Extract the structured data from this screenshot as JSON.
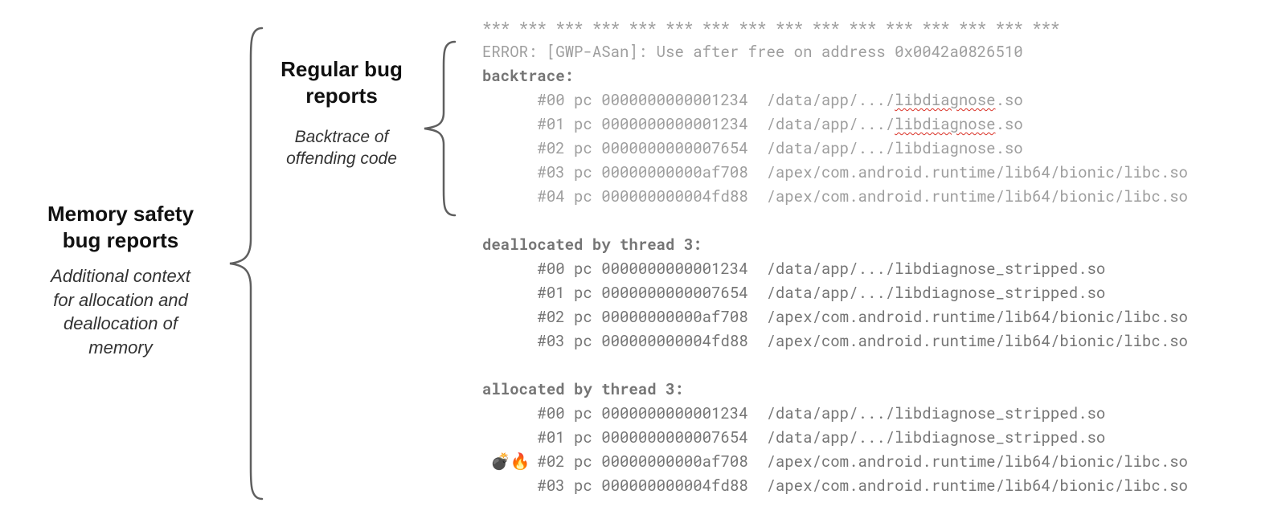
{
  "outer": {
    "title1": "Memory safety",
    "title2": "bug reports",
    "desc1": "Additional context",
    "desc2": "for allocation and",
    "desc3": "deallocation of",
    "desc4": "memory"
  },
  "inner": {
    "title1": "Regular bug",
    "title2": "reports",
    "desc1": "Backtrace of",
    "desc2": "offending code"
  },
  "code": {
    "stars": "*** *** *** *** *** *** *** *** *** *** *** *** *** *** *** ***",
    "error": "ERROR: [GWP-ASan]: Use after free on address 0x0042a0826510",
    "backtrace_hdr": "backtrace:",
    "bt0a": "      #00 pc 0000000000001234  /data/app/.../",
    "bt0b": "libdiagnose",
    "bt0c": ".so",
    "bt1a": "      #01 pc 0000000000001234  /data/app/.../",
    "bt1b": "libdiagnose",
    "bt1c": ".so",
    "bt2": "      #02 pc 0000000000007654  /data/app/.../libdiagnose.so",
    "bt3": "      #03 pc 00000000000af708  /apex/com.android.runtime/lib64/bionic/libc.so",
    "bt4": "      #04 pc 000000000004fd88  /apex/com.android.runtime/lib64/bionic/libc.so",
    "dealloc_hdr": "deallocated by thread 3:",
    "d0": "      #00 pc 0000000000001234  /data/app/.../libdiagnose_stripped.so",
    "d1": "      #01 pc 0000000000007654  /data/app/.../libdiagnose_stripped.so",
    "d2": "      #02 pc 00000000000af708  /apex/com.android.runtime/lib64/bionic/libc.so",
    "d3": "      #03 pc 000000000004fd88  /apex/com.android.runtime/lib64/bionic/libc.so",
    "alloc_hdr": "allocated by thread 3:",
    "a0": "      #00 pc 0000000000001234  /data/app/.../libdiagnose_stripped.so",
    "a1": "      #01 pc 0000000000007654  /data/app/.../libdiagnose_stripped.so",
    "a2": "      #02 pc 00000000000af708  /apex/com.android.runtime/lib64/bionic/libc.so",
    "a3": "      #03 pc 000000000004fd88  /apex/com.android.runtime/lib64/bionic/libc.so"
  },
  "marker": {
    "emoji": "💣🔥"
  }
}
